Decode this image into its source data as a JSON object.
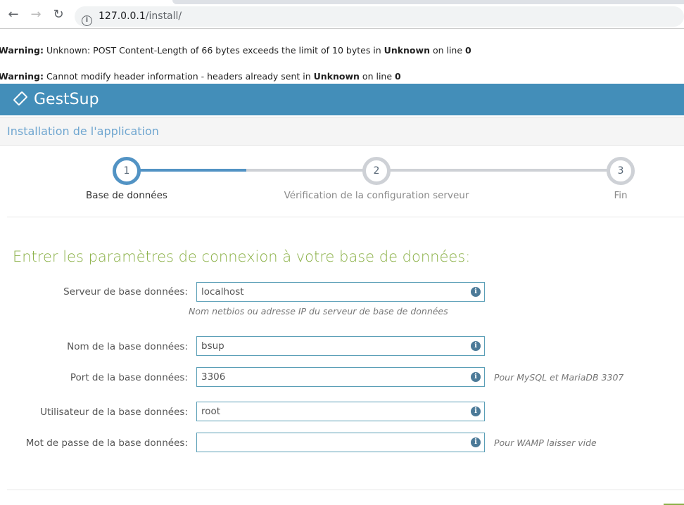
{
  "browser": {
    "url_host": "127.0.0.1",
    "url_path": "/install/",
    "back": "←",
    "forward": "→",
    "reload": "↻"
  },
  "warnings": [
    {
      "label": "Warning:",
      "text1": " Unknown: POST Content-Length of 66 bytes exceeds the limit of 10 bytes in ",
      "bold": "Unknown",
      "text2": " on line ",
      "line": "0"
    },
    {
      "label": "Warning:",
      "text1": " Cannot modify header information - headers already sent in ",
      "bold": "Unknown",
      "text2": " on line ",
      "line": "0"
    }
  ],
  "app": {
    "name": "GestSup",
    "breadcrumb": "Installation de l'application"
  },
  "steps": [
    {
      "num": "1",
      "label": "Base de données",
      "active": true
    },
    {
      "num": "2",
      "label": "Vérification de la configuration serveur",
      "active": false
    },
    {
      "num": "3",
      "label": "Fin",
      "active": false
    }
  ],
  "progress_percent": 17,
  "form": {
    "heading": "Entrer les paramètres de connexion à votre base de données:",
    "fields": [
      {
        "label": "Serveur de base données:",
        "value": "localhost",
        "help": "Nom netbios ou adresse IP du serveur de base de données",
        "note": ""
      },
      {
        "label": "Nom de la base données:",
        "value": "bsup",
        "note": ""
      },
      {
        "label": "Port de la base données:",
        "value": "3306",
        "note": "Pour MySQL et MariaDB 3307"
      },
      {
        "label": "Utilisateur de la base données:",
        "value": "root",
        "note": ""
      },
      {
        "label": "Mot de passe de la base données:",
        "value": "",
        "note": "Pour WAMP laisser vide"
      }
    ]
  },
  "colors": {
    "header": "#438eb9",
    "accent_green": "#8ab046",
    "step_active": "#5293c4",
    "step_inactive": "#ced1d6"
  }
}
